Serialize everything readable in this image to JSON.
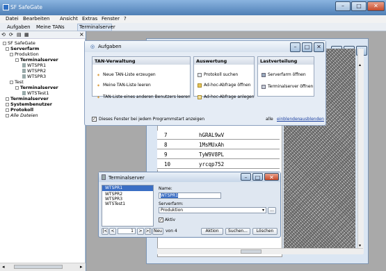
{
  "window": {
    "title": "SF SafeGate",
    "controls": [
      "–",
      "□",
      "✕"
    ]
  },
  "menu": [
    "Datei",
    "Bearbeiten",
    "Ansicht",
    "Extras",
    "Fenster",
    "?"
  ],
  "tabs": {
    "aufgaben": "Aufgaben",
    "meine_tans": "Meine TANs",
    "terminalserver": "Terminalserver",
    "close": "×"
  },
  "tree": [
    {
      "label": "SF SafeGate",
      "bold": false
    },
    {
      "label": "Serverfarm",
      "bold": true
    },
    {
      "label": "Produktion",
      "bold": false
    },
    {
      "label": "Terminalserver",
      "bold": true
    },
    {
      "label": "WTSPR1",
      "bold": false
    },
    {
      "label": "WTSPR2",
      "bold": false
    },
    {
      "label": "WTSPR3",
      "bold": false
    },
    {
      "label": "Test",
      "bold": false
    },
    {
      "label": "Terminalserver",
      "bold": true
    },
    {
      "label": "WTSTest1",
      "bold": false
    },
    {
      "label": "Terminalserver",
      "bold": true
    },
    {
      "label": "Systembenutzer",
      "bold": true
    },
    {
      "label": "Protokoll",
      "bold": true
    },
    {
      "label": "Alle Dateien",
      "bold": false
    }
  ],
  "aufgaben": {
    "title": "Aufgaben",
    "tan_header": "TAN-Verwaltung",
    "tan_items": [
      "Neue TAN-Liste erzeugen",
      "Meine TAN-Liste leeren",
      "TAN-Liste eines anderen Benutzers leeren"
    ],
    "auswertung_header": "Auswertung",
    "auswertung_items": [
      "Protokoll suchen",
      "Ad-hoc-Abfrage öffnen",
      "Ad-hoc-Abfrage anlegen"
    ],
    "last_header": "Lastverteilung",
    "last_items": [
      "Serverfarm öffnen",
      "Terminalserver öffnen"
    ],
    "checkbox_label": "Dieses Fenster bei jedem Programmstart anzeigen",
    "alle": "alle",
    "einblenden": "einblenden",
    "ausblenden": "ausblenden"
  },
  "tan_rows": [
    {
      "n": "7",
      "v": "hGRAL9wV"
    },
    {
      "n": "8",
      "v": "1MsMUxAh"
    },
    {
      "n": "9",
      "v": "TyW9V8PL"
    },
    {
      "n": "10",
      "v": "yrcqp752"
    }
  ],
  "ts_dialog": {
    "title": "Terminalserver",
    "list": [
      "WTSPR1",
      "WTSPR2",
      "WTSPR3",
      "WTSTest1"
    ],
    "name_label": "Name:",
    "name_value": "WTSPR1",
    "serverfarm_label": "Serverfarm:",
    "serverfarm_value": "Produktion",
    "aktiv_label": "Aktiv",
    "nav_first": "|<",
    "nav_prev": "<",
    "record": "1",
    "nav_next": ">",
    "nav_last": ">|",
    "neu": "Neu",
    "von": "von 4",
    "aktion": "Aktion",
    "suchen": "Suchen...",
    "loeschen": "Löschen",
    "browse": "..."
  },
  "colors": {
    "titlebar": "#4f7fb5",
    "desktop": "#a9a9a9",
    "link": "#1a3fa0",
    "selection": "#3a6ec4"
  }
}
